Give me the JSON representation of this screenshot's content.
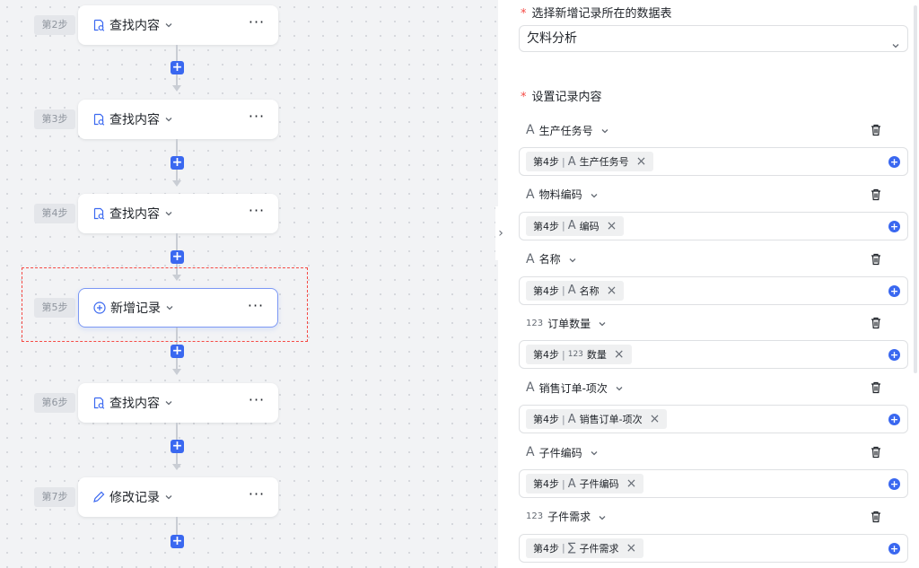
{
  "canvas": {
    "steps": [
      {
        "badge": "第2步",
        "title": "查找内容",
        "icon": "search-doc-icon"
      },
      {
        "badge": "第3步",
        "title": "查找内容",
        "icon": "search-doc-icon"
      },
      {
        "badge": "第4步",
        "title": "查找内容",
        "icon": "search-doc-icon"
      },
      {
        "badge": "第5步",
        "title": "新增记录",
        "icon": "add-circle-icon"
      },
      {
        "badge": "第6步",
        "title": "查找内容",
        "icon": "search-doc-icon"
      },
      {
        "badge": "第7步",
        "title": "修改记录",
        "icon": "edit-pencil-icon"
      }
    ],
    "more_label": "···",
    "add_label": "+"
  },
  "panel": {
    "table_section_label": "选择新增记录所在的数据表",
    "table_selected": "欠料分析",
    "content_section_label": "设置记录内容",
    "required_mark": "*",
    "fields": [
      {
        "type_icon": "A",
        "name": "生产任务号",
        "chip_step": "第4步",
        "chip_icon": "A",
        "chip_field": "生产任务号"
      },
      {
        "type_icon": "A",
        "name": "物料编码",
        "chip_step": "第4步",
        "chip_icon": "A",
        "chip_field": "编码"
      },
      {
        "type_icon": "A",
        "name": "名称",
        "chip_step": "第4步",
        "chip_icon": "A",
        "chip_field": "名称"
      },
      {
        "type_icon": "123",
        "name": "订单数量",
        "chip_step": "第4步",
        "chip_icon": "123",
        "chip_field": "数量"
      },
      {
        "type_icon": "A",
        "name": "销售订单-项次",
        "chip_step": "第4步",
        "chip_icon": "A",
        "chip_field": "销售订单-项次"
      },
      {
        "type_icon": "A",
        "name": "子件编码",
        "chip_step": "第4步",
        "chip_icon": "A",
        "chip_field": "子件编码"
      },
      {
        "type_icon": "123",
        "name": "子件需求",
        "chip_step": "第4步",
        "chip_icon": "∑",
        "chip_field": "子件需求"
      }
    ],
    "remove_label": "×",
    "add_label": "+"
  },
  "colors": {
    "accent": "#3a68f0",
    "required": "#f54a45",
    "selection": "#f54a45"
  }
}
